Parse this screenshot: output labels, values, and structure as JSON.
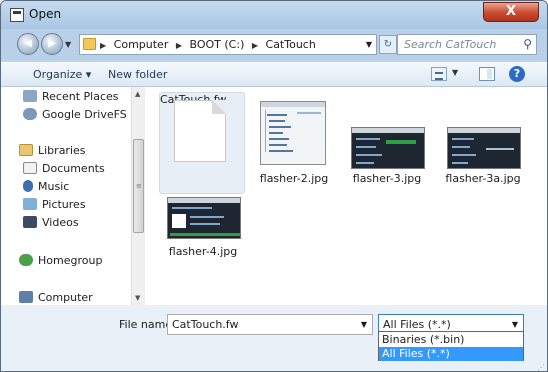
{
  "window": {
    "title": "Open",
    "close_label": "X"
  },
  "navigation": {
    "breadcrumbs": [
      "Computer",
      "BOOT (C:)",
      "CatTouch"
    ],
    "search_placeholder": "Search CatTouch"
  },
  "toolbar": {
    "organize_label": "Organize ▾",
    "new_folder_label": "New folder",
    "help_label": "?"
  },
  "nav_pane": {
    "items": [
      "Recent Places",
      "Google DriveFS",
      "Libraries",
      "Documents",
      "Music",
      "Pictures",
      "Videos",
      "Homegroup",
      "Computer"
    ]
  },
  "files": [
    {
      "name": "CatTouch.fw",
      "kind": "blank-document"
    },
    {
      "name": "flasher-2.jpg",
      "kind": "screenshot-light"
    },
    {
      "name": "flasher-3.jpg",
      "kind": "screenshot-dark"
    },
    {
      "name": "flasher-3a.jpg",
      "kind": "screenshot-dark"
    },
    {
      "name": "flasher-4.jpg",
      "kind": "screenshot-dark"
    }
  ],
  "file_name": {
    "label": "File name:",
    "value": "CatTouch.fw"
  },
  "file_type": {
    "selected": "All Files (*.*)",
    "options": [
      "Binaries (*.bin)",
      "All Files (*.*)"
    ],
    "highlighted_index": 1
  },
  "colors": {
    "accent": "#3399ff",
    "close_red": "#c94b2d",
    "selection_bg": "#e8eef5"
  }
}
